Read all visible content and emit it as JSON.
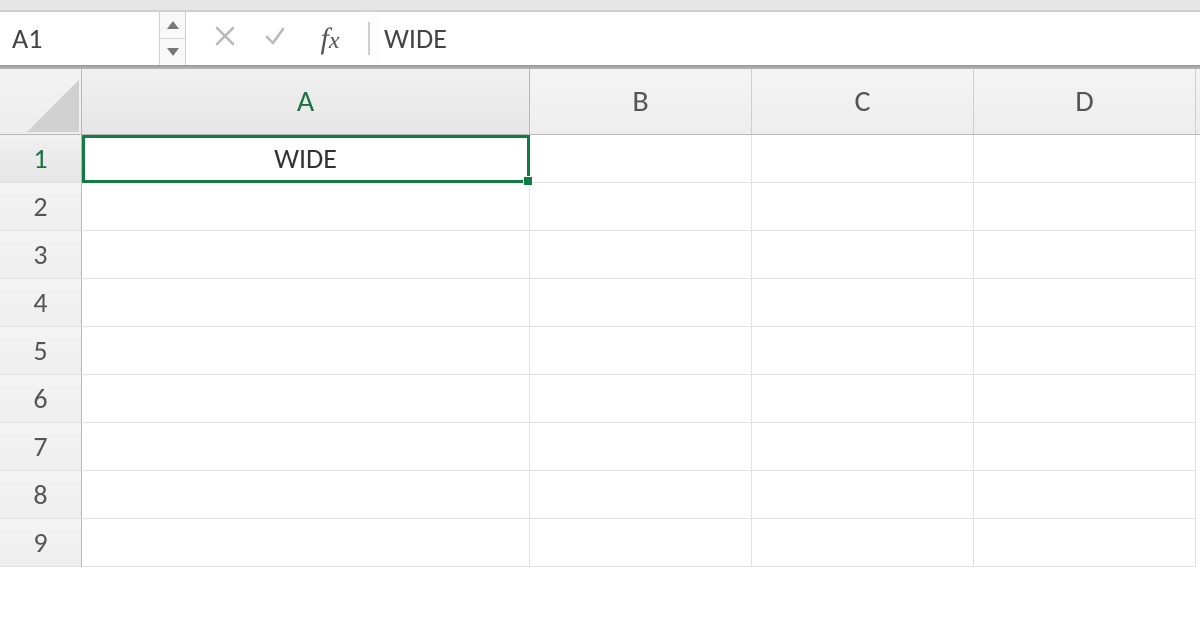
{
  "formula_bar": {
    "name_box_value": "A1",
    "formula_value": "WIDE",
    "icons": {
      "cancel": "cancel-icon",
      "enter": "enter-icon",
      "fx": "insert-function-icon"
    }
  },
  "columns": [
    "A",
    "B",
    "C",
    "D"
  ],
  "rows": [
    "1",
    "2",
    "3",
    "4",
    "5",
    "6",
    "7",
    "8",
    "9"
  ],
  "active_cell": {
    "col": "A",
    "row": "1"
  },
  "cells": {
    "A1": "WIDE"
  },
  "chart_data": {
    "type": "table",
    "columns": [
      "A",
      "B",
      "C",
      "D"
    ],
    "rows": [
      {
        "row": "1",
        "values": [
          "WIDE",
          "",
          "",
          ""
        ]
      },
      {
        "row": "2",
        "values": [
          "",
          "",
          "",
          ""
        ]
      },
      {
        "row": "3",
        "values": [
          "",
          "",
          "",
          ""
        ]
      },
      {
        "row": "4",
        "values": [
          "",
          "",
          "",
          ""
        ]
      },
      {
        "row": "5",
        "values": [
          "",
          "",
          "",
          ""
        ]
      },
      {
        "row": "6",
        "values": [
          "",
          "",
          "",
          ""
        ]
      },
      {
        "row": "7",
        "values": [
          "",
          "",
          "",
          ""
        ]
      },
      {
        "row": "8",
        "values": [
          "",
          "",
          "",
          ""
        ]
      },
      {
        "row": "9",
        "values": [
          "",
          "",
          "",
          ""
        ]
      }
    ],
    "title": "",
    "xlabel": "",
    "ylabel": ""
  },
  "colors": {
    "selection": "#107c41",
    "header_active_text": "#1e7145",
    "gridline": "#e2e2e2"
  }
}
